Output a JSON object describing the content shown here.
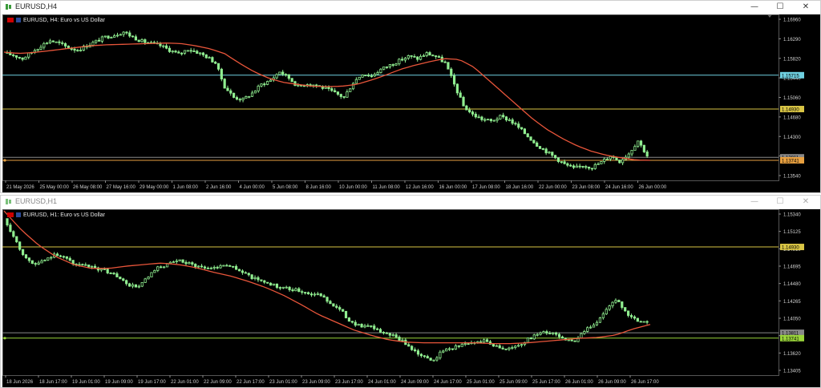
{
  "window1": {
    "title": "EURUSD,H4",
    "chart_title": "EURUSD, H4:  Euro vs US Dollar",
    "buttons": [
      "—",
      "☐",
      "✕"
    ]
  },
  "window2": {
    "title": "EURUSD,H1",
    "chart_title": "EURUSD, H1:  Euro vs US Dollar",
    "buttons": [
      "—",
      "☐",
      "✕"
    ]
  },
  "colors": {
    "bg": "#000000",
    "candle": "#90ee90",
    "ma": "#e8553a",
    "line_yellow": "#d9c545",
    "line_cyan": "#6fd0e0",
    "line_green": "#9ad53a",
    "line_orange": "#e8a040"
  },
  "chart_data": [
    {
      "type": "candlestick",
      "timeframe": "H4",
      "y_ticks": [
        "1.16960",
        "1.16290",
        "1.15820",
        "1.15440",
        "1.15060",
        "1.14680",
        "1.14300",
        "1.13920",
        "1.13540"
      ],
      "ylim": [
        1.1335,
        1.1705
      ],
      "x_ticks": [
        "21 May 2026",
        "25 May 00:00",
        "26 May 08:00",
        "27 May 16:00",
        "29 May 00:00",
        "1 Jun 08:00",
        "2 Jun 16:00",
        "4 Jun 00:00",
        "5 Jun 08:00",
        "8 Jun 16:00",
        "10 Jun 00:00",
        "11 Jun 08:00",
        "12 Jun 16:00",
        "16 Jun 00:00",
        "17 Jun 08:00",
        "18 Jun 16:00",
        "22 Jun 00:00",
        "23 Jun 08:00",
        "24 Jun 16:00",
        "26 Jun 00:00"
      ],
      "hlines": [
        {
          "price": 1.15715,
          "label": "1.15715",
          "color": "#6fd0e0"
        },
        {
          "price": 1.1493,
          "label": "1.14930",
          "color": "#d9c545"
        },
        {
          "price": 1.13811,
          "label": "1.13811",
          "color": "#888888"
        },
        {
          "price": 1.13741,
          "label": "1.13741",
          "color": "#e8a040"
        }
      ],
      "close_path": [
        1.1622,
        1.1618,
        1.161,
        1.1625,
        1.164,
        1.1652,
        1.1645,
        1.1635,
        1.163,
        1.164,
        1.165,
        1.166,
        1.1665,
        1.1672,
        1.166,
        1.165,
        1.1645,
        1.164,
        1.163,
        1.162,
        1.1632,
        1.1625,
        1.1615,
        1.16,
        1.1545,
        1.152,
        1.1515,
        1.153,
        1.155,
        1.156,
        1.158,
        1.1565,
        1.1545,
        1.1552,
        1.1548,
        1.154,
        1.153,
        1.152,
        1.1555,
        1.1575,
        1.157,
        1.1585,
        1.1595,
        1.1605,
        1.1615,
        1.161,
        1.1622,
        1.1615,
        1.16,
        1.155,
        1.15,
        1.148,
        1.147,
        1.1465,
        1.1475,
        1.1468,
        1.145,
        1.143,
        1.141,
        1.1395,
        1.138,
        1.1365,
        1.1355,
        1.1362,
        1.1358,
        1.137,
        1.1385,
        1.1372,
        1.139,
        1.142,
        1.1385
      ],
      "ma_path": [
        1.1625,
        1.1622,
        1.1624,
        1.1628,
        1.1632,
        1.1636,
        1.164,
        1.1642,
        1.1643,
        1.1644,
        1.1645,
        1.1646,
        1.1645,
        1.164,
        1.1633,
        1.1622,
        1.16,
        1.158,
        1.1565,
        1.1555,
        1.155,
        1.1546,
        1.1545,
        1.1546,
        1.155,
        1.156,
        1.1572,
        1.1585,
        1.1595,
        1.1603,
        1.161,
        1.1608,
        1.159,
        1.156,
        1.153,
        1.15,
        1.147,
        1.1445,
        1.1425,
        1.1408,
        1.1395,
        1.1386,
        1.138,
        1.1375,
        1.1374
      ]
    },
    {
      "type": "candlestick",
      "timeframe": "H1",
      "y_ticks": [
        "1.15340",
        "1.15125",
        "1.14910",
        "1.14695",
        "1.14480",
        "1.14265",
        "1.14050",
        "1.13835",
        "1.13620",
        "1.13405"
      ],
      "ylim": [
        1.133,
        1.1538
      ],
      "x_ticks": [
        "18 Jun 2026",
        "18 Jun 17:00",
        "19 Jun 01:00",
        "19 Jun 09:00",
        "19 Jun 17:00",
        "22 Jun 01:00",
        "22 Jun 09:00",
        "22 Jun 17:00",
        "23 Jun 01:00",
        "23 Jun 09:00",
        "23 Jun 17:00",
        "24 Jun 01:00",
        "24 Jun 09:00",
        "24 Jun 17:00",
        "25 Jun 01:00",
        "25 Jun 09:00",
        "25 Jun 17:00",
        "26 Jun 01:00",
        "26 Jun 09:00",
        "26 Jun 17:00"
      ],
      "hlines": [
        {
          "price": 1.1493,
          "label": "1.14930",
          "color": "#d9c545"
        },
        {
          "price": 1.13811,
          "label": "1.13811",
          "color": "#888888"
        },
        {
          "price": 1.13741,
          "label": "1.13741",
          "color": "#9ad53a"
        }
      ],
      "close_path": [
        1.153,
        1.1505,
        1.148,
        1.147,
        1.1475,
        1.1485,
        1.1478,
        1.147,
        1.1468,
        1.1465,
        1.1462,
        1.1455,
        1.1445,
        1.144,
        1.1452,
        1.1465,
        1.147,
        1.1475,
        1.1472,
        1.1468,
        1.1465,
        1.1468,
        1.147,
        1.1462,
        1.1455,
        1.145,
        1.1445,
        1.144,
        1.1438,
        1.1436,
        1.1432,
        1.143,
        1.142,
        1.141,
        1.1395,
        1.139,
        1.1388,
        1.1382,
        1.1378,
        1.137,
        1.136,
        1.135,
        1.1345,
        1.1358,
        1.1362,
        1.1366,
        1.1368,
        1.1372,
        1.1365,
        1.136,
        1.1362,
        1.137,
        1.1378,
        1.1382,
        1.138,
        1.1372,
        1.137,
        1.1385,
        1.1395,
        1.141,
        1.1425,
        1.1405,
        1.1398,
        1.1393
      ],
      "ma_path": [
        1.154,
        1.1515,
        1.1495,
        1.148,
        1.147,
        1.1465,
        1.1465,
        1.1468,
        1.147,
        1.1472,
        1.147,
        1.1466,
        1.146,
        1.1455,
        1.1448,
        1.144,
        1.143,
        1.1418,
        1.1405,
        1.1395,
        1.1385,
        1.1378,
        1.1372,
        1.1369,
        1.1368,
        1.1368,
        1.1368,
        1.1368,
        1.1367,
        1.1367,
        1.1368,
        1.137,
        1.1372,
        1.1374,
        1.1375,
        1.1378,
        1.1386,
        1.1392
      ]
    }
  ]
}
